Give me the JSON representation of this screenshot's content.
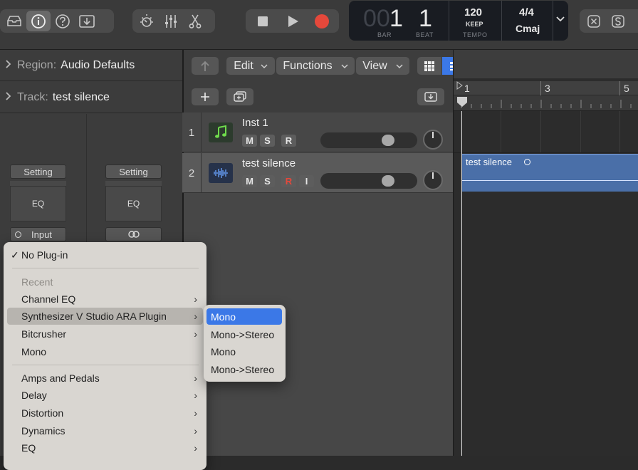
{
  "transport": {
    "bar_dim": "00",
    "bar": "1",
    "beat": "1",
    "bar_label": "BAR",
    "beat_label": "BEAT",
    "tempo": "120",
    "tempo_mode": "KEEP",
    "tempo_label": "TEMPO",
    "signature": "4/4",
    "key": "Cmaj"
  },
  "inspector": {
    "region_key": "Region:",
    "region_value": "Audio Defaults",
    "track_key": "Track:",
    "track_value": "test silence",
    "strip1": {
      "setting": "Setting",
      "eq": "EQ",
      "input": "Input"
    },
    "strip2": {
      "setting": "Setting",
      "eq": "EQ"
    }
  },
  "toolbar": {
    "edit": "Edit",
    "functions": "Functions",
    "view": "View"
  },
  "ruler": {
    "marks": [
      "1",
      "3",
      "5"
    ]
  },
  "tracks": [
    {
      "number": "1",
      "name": "Inst 1",
      "buttons": [
        "M",
        "S",
        "R"
      ]
    },
    {
      "number": "2",
      "name": "test silence",
      "buttons": [
        "M",
        "S",
        "R",
        "I"
      ]
    }
  ],
  "region": {
    "name": "test silence"
  },
  "menu": {
    "no_plugin": "No Plug-in",
    "check": "✓",
    "recent_header": "Recent",
    "items_recent": [
      "Channel EQ",
      "Synthesizer V Studio ARA Plugin",
      "Bitcrusher",
      "Mono"
    ],
    "items_categories": [
      "Amps and Pedals",
      "Delay",
      "Distortion",
      "Dynamics",
      "EQ"
    ],
    "arrow": "›"
  },
  "submenu": {
    "items": [
      "Mono",
      "Mono->Stereo",
      "Mono",
      "Mono->Stereo"
    ]
  },
  "colors": {
    "record": "#e5483b",
    "accent": "#3b78e7",
    "region": "#4a6fa8",
    "inst_icon": "#2e7d32"
  }
}
